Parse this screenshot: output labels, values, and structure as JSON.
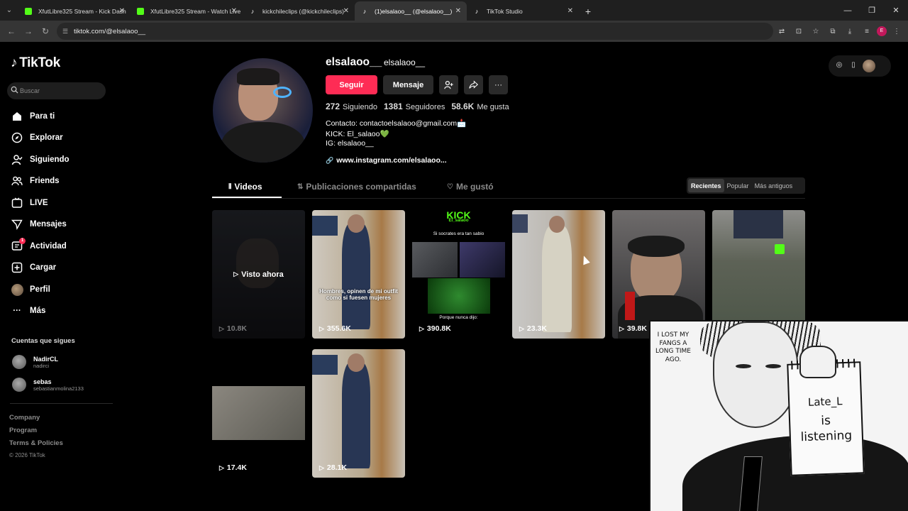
{
  "browser": {
    "tabs": [
      {
        "title": "XfutLibre325 Stream - Kick Dash",
        "favicon": "kick"
      },
      {
        "title": "XfutLibre325 Stream - Watch Live",
        "favicon": "kick"
      },
      {
        "title": "kickchileclips (@kickchileclips)",
        "favicon": "tiktok"
      },
      {
        "title": "(1)elsalaoo__ (@elsalaoo__)",
        "favicon": "tiktok",
        "active": true
      },
      {
        "title": "TikTok Studio",
        "favicon": "tiktok"
      }
    ],
    "url": "tiktok.com/@elsalaoo__",
    "profile_initial": "E"
  },
  "sidebar": {
    "logo": "TikTok",
    "search_placeholder": "Buscar",
    "nav": [
      {
        "label": "Para ti",
        "icon": "home-icon"
      },
      {
        "label": "Explorar",
        "icon": "compass-icon"
      },
      {
        "label": "Siguiendo",
        "icon": "following-icon"
      },
      {
        "label": "Friends",
        "icon": "friends-icon"
      },
      {
        "label": "LIVE",
        "icon": "live-icon"
      },
      {
        "label": "Mensajes",
        "icon": "messages-icon"
      },
      {
        "label": "Actividad",
        "icon": "activity-icon",
        "badge": "1"
      },
      {
        "label": "Cargar",
        "icon": "upload-icon"
      },
      {
        "label": "Perfil",
        "icon": "avatar"
      },
      {
        "label": "Más",
        "icon": "more-icon"
      }
    ],
    "following_title": "Cuentas que sigues",
    "following": [
      {
        "name": "NadirCL",
        "handle": "nadirci"
      },
      {
        "name": "sebas",
        "handle": "sebastianmolina2133"
      }
    ],
    "footer": [
      "Company",
      "Program",
      "Terms & Policies"
    ],
    "copyright": "© 2026 TikTok"
  },
  "profile": {
    "username": "elsalaoo__",
    "nickname": "elsalaoo__",
    "follow_label": "Seguir",
    "message_label": "Mensaje",
    "stats": {
      "following": "272",
      "following_label": "Siguiendo",
      "followers": "1381",
      "followers_label": "Seguidores",
      "likes": "58.6K",
      "likes_label": "Me gusta"
    },
    "bio": [
      "Contacto: contactoelsalaoo@gmail.com📩",
      "KICK: El_salaoo💚",
      "IG: elsalaoo__"
    ],
    "link": "www.instagram.com/elsalaoo..."
  },
  "tabs": {
    "videos": "Videos",
    "reposts": "Publicaciones compartidas",
    "liked": "Me gustó"
  },
  "sort": [
    "Recientes",
    "Popular",
    "Más antiguos"
  ],
  "videos": [
    {
      "views": "10.8K",
      "overlay": "Visto ahora",
      "caption": ""
    },
    {
      "views": "355.6K",
      "caption": "Hombres, opinen de mi outfit como si fuesen mujeres"
    },
    {
      "views": "390.8K",
      "caption_top": "KICK",
      "caption_sub": "El_salaoo",
      "caption_mid": "Si socrates era tan sabio",
      "caption_bottom": "Porque nunca dijo:"
    },
    {
      "views": "23.3K",
      "caption": ""
    },
    {
      "views": "39.8K",
      "caption": ""
    },
    {
      "views": "",
      "caption": ""
    },
    {
      "views": "17.4K",
      "caption": ""
    },
    {
      "views": "28.1K",
      "caption": ""
    }
  ],
  "overlay": {
    "bubble": "I LOST MY FANGS A LONG TIME AGO.",
    "pad_line1": "Late_L",
    "pad_line2": "is",
    "pad_line3": "listening"
  },
  "colors": {
    "accent": "#fe2c55",
    "kick_green": "#53fc18",
    "background": "#000000"
  }
}
